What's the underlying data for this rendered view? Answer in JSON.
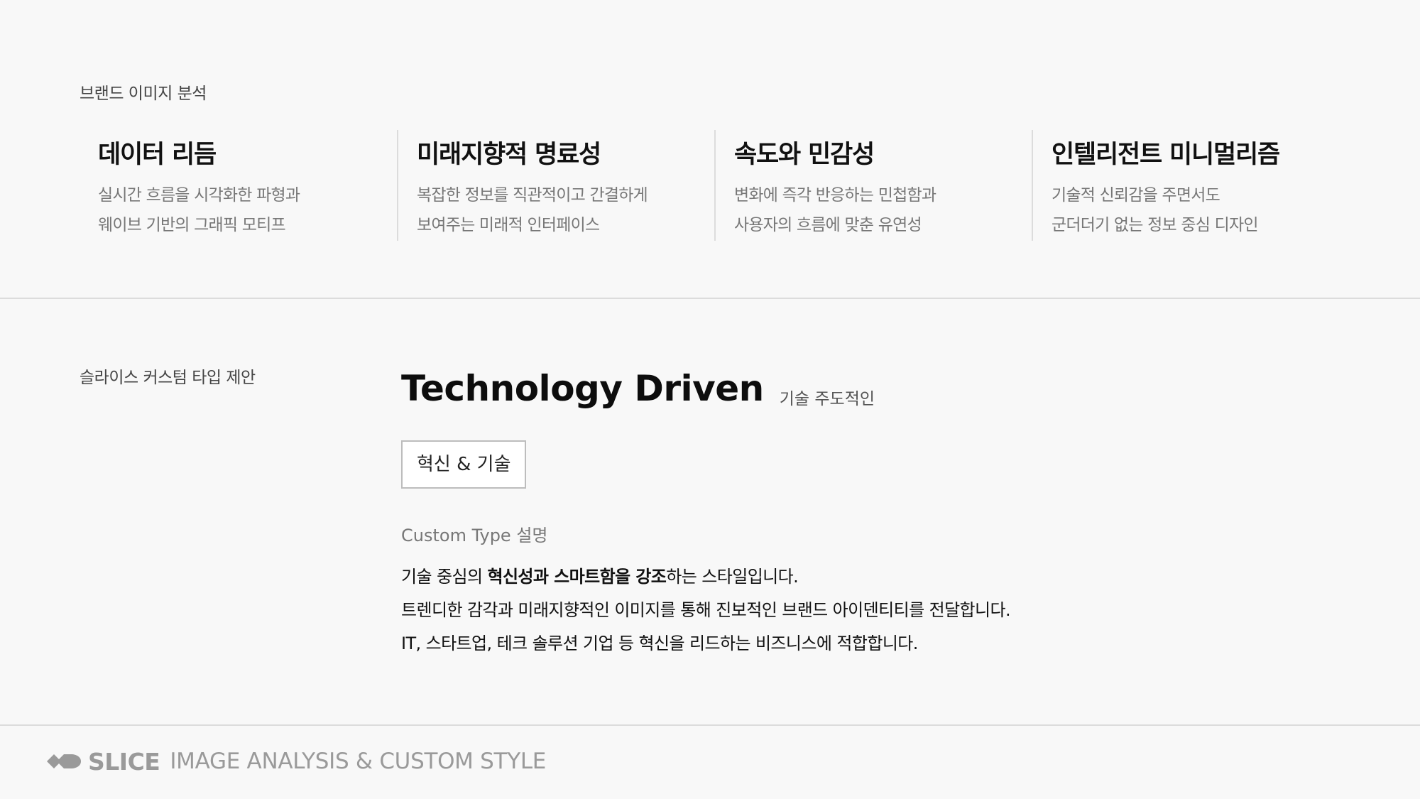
{
  "brand_analysis": {
    "label": "브랜드 이미지 분석",
    "cards": [
      {
        "title": "데이터 리듬",
        "line1": "실시간 흐름을 시각화한 파형과",
        "line2": "웨이브 기반의 그래픽 모티프"
      },
      {
        "title": "미래지향적 명료성",
        "line1": "복잡한 정보를 직관적이고 간결하게",
        "line2": "보여주는 미래적 인터페이스"
      },
      {
        "title": "속도와 민감성",
        "line1": "변화에 즉각 반응하는 민첩함과",
        "line2": "사용자의 흐름에 맞춘 유연성"
      },
      {
        "title": "인텔리전트 미니멀리즘",
        "line1": "기술적 신뢰감을 주면서도",
        "line2": "군더더기 없는 정보 중심 디자인"
      }
    ]
  },
  "custom_type": {
    "label": "슬라이스 커스텀 타입 제안",
    "title": "Technology Driven",
    "subtitle": "기술 주도적인",
    "tag": "혁신 & 기술",
    "desc_heading": "Custom Type 설명",
    "line1": {
      "pre": "기술 중심의 ",
      "bold": "혁신성과 스마트함을 강조",
      "post": "하는 스타일입니다."
    },
    "line2": "트렌디한 감각과 미래지향적인 이미지를 통해 진보적인 브랜드 아이덴티티를 전달합니다.",
    "line3": "IT, 스타트업, 테크 솔루션 기업 등 혁신을 리드하는 비즈니스에 적합합니다."
  },
  "footer": {
    "logo_icon": "slice-logo-icon",
    "logo": "SLICE",
    "tagline": "IMAGE ANALYSIS & CUSTOM STYLE",
    "colors": {
      "logo": "#9a9a9a"
    }
  }
}
